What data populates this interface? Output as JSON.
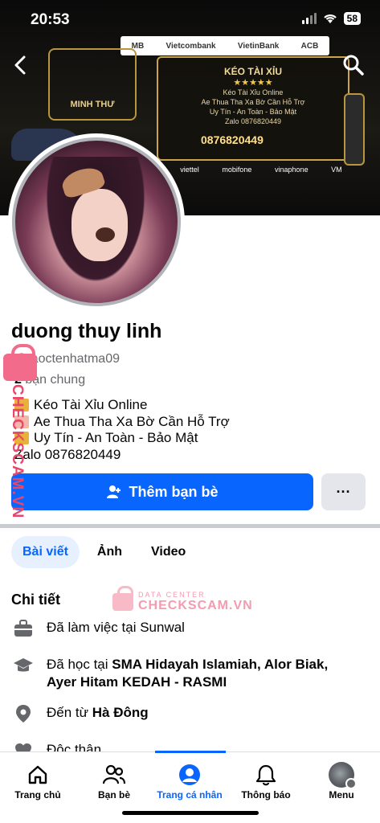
{
  "status_bar": {
    "time": "20:53",
    "battery": "58"
  },
  "cover": {
    "top_banks": [
      "MB",
      "Vietcombank",
      "VietinBank",
      "ACB"
    ],
    "logo_label": "MINH THƯ",
    "panel_title": "KÉO TÀI XỈU",
    "panel_stars": "★★★★★",
    "panel_lines": [
      "Kéo Tài Xỉu Online",
      "Ae Thua Tha Xa Bờ Cần Hỗ Trợ",
      "Uy Tín - An Toàn - Bảo Mật",
      "Zalo 0876820449"
    ],
    "panel_phone": "0876820449",
    "telcos": [
      "viettel",
      "mobifone",
      "vinaphone",
      "VM"
    ]
  },
  "profile": {
    "name": "duong thuy linh",
    "username": "@taoctenhatma09",
    "mutual_count": "2",
    "mutual_label": "bạn chung",
    "bio": [
      {
        "text": "Kéo Tài Xỉu Online",
        "emoji_color": "#e8b23a"
      },
      {
        "text": "Ae Thua Tha Xa Bờ Cần Hỗ Trợ",
        "emoji_color": "#f4b6a8"
      },
      {
        "text": "Uy Tín - An Toàn - Bảo Mật",
        "emoji_color": "#e8b23a"
      }
    ],
    "zalo": "Zalo 0876820449"
  },
  "actions": {
    "add_friend_label": "Thêm bạn bè",
    "more_label": "···"
  },
  "tabs": [
    {
      "label": "Bài viết",
      "active": true
    },
    {
      "label": "Ảnh",
      "active": false
    },
    {
      "label": "Video",
      "active": false
    }
  ],
  "details": {
    "title": "Chi tiết",
    "work": {
      "prefix": "Đã làm việc tại ",
      "place": "Sunwal",
      "icon": "briefcase-icon"
    },
    "education": {
      "prefix": "Đã học tại ",
      "place": "SMA Hidayah Islamiah, Alor Biak, Ayer Hitam KEDAH - RASMI",
      "icon": "graduation-cap-icon"
    },
    "hometown": {
      "prefix": "Đến từ ",
      "place": "Hà Đông",
      "icon": "location-pin-icon"
    },
    "relationship": {
      "text": "Độc thân",
      "icon": "heart-icon"
    }
  },
  "watermark": {
    "side_text": "CHECKSCAM.VN",
    "center_small": "DATA CENTER",
    "center_big": "CHECKSCAM.VN"
  },
  "bottom_nav": [
    {
      "label": "Trang chủ",
      "icon": "home-icon"
    },
    {
      "label": "Bạn bè",
      "icon": "friends-icon"
    },
    {
      "label": "Trang cá nhân",
      "icon": "profile-icon",
      "active": true
    },
    {
      "label": "Thông báo",
      "icon": "bell-icon"
    },
    {
      "label": "Menu",
      "icon": "menu-avatar-icon"
    }
  ],
  "colors": {
    "accent": "#0866ff",
    "watermark": "#e8476c"
  }
}
